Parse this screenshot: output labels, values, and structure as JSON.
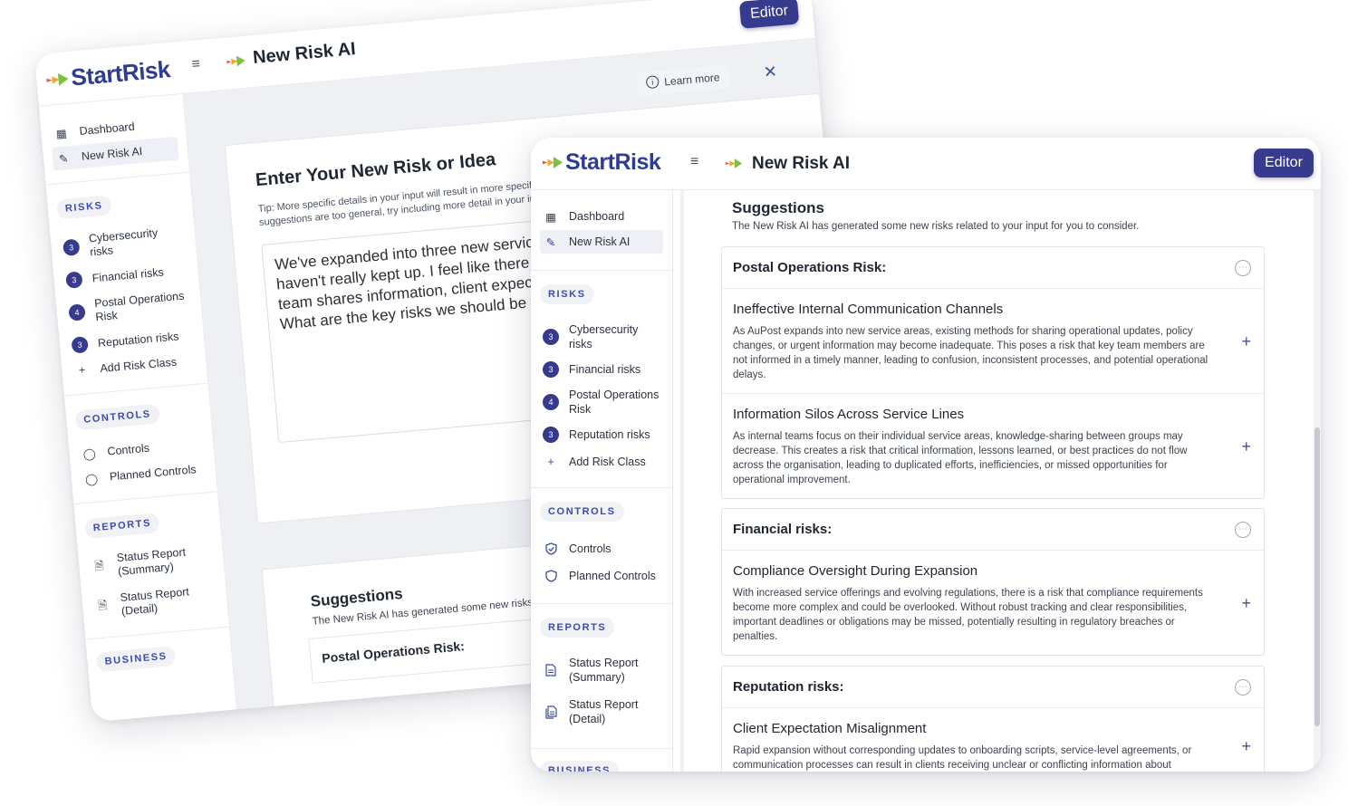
{
  "brand": {
    "logo_start": "Start",
    "logo_risk": "Risk"
  },
  "header": {
    "page_title": "New Risk AI",
    "editor_label": "Editor"
  },
  "sidebar": {
    "dashboard": "Dashboard",
    "new_risk_ai": "New Risk AI",
    "risks_label": "RISKS",
    "risk_classes": [
      {
        "count": "3",
        "line1": "Cybersecurity",
        "line2": "risks"
      },
      {
        "count": "3",
        "line1": "Financial risks",
        "line2": ""
      },
      {
        "count": "4",
        "line1": "Postal Operations",
        "line2": "Risk"
      },
      {
        "count": "3",
        "line1": "Reputation risks",
        "line2": ""
      }
    ],
    "add_risk_class": "Add Risk Class",
    "controls_label": "CONTROLS",
    "controls": "Controls",
    "planned_controls": "Planned Controls",
    "reports_label": "REPORTS",
    "status_summary_1": "Status Report",
    "status_summary_2": "(Summary)",
    "status_detail_1": "Status Report",
    "status_detail_2": "(Detail)",
    "business_label": "BUSINESS"
  },
  "back_window": {
    "learn_more": "Learn more",
    "card_title": "Enter Your New Risk or Idea",
    "tip_line1": "Tip: More specific details in your input will result in more specific",
    "tip_line2": "suggestions are too general, try including more detail in your input",
    "input_text": "We've expanded into three new service areas, but our internal processes haven't really kept up. I feel like there are gaps, especially around how our team shares information, client expectations, and keeps track of compliance. What are the key risks we should be thinking about?",
    "suggestions_title": "Suggestions",
    "suggestions_sub": "The New Risk AI has generated some new risks related to your input for you to consider.",
    "group_title": "Postal Operations Risk:"
  },
  "suggestions": {
    "title": "Suggestions",
    "subtitle": "The New Risk AI has generated some new risks related to your input for you to consider.",
    "groups": [
      {
        "title": "Postal Operations Risk:",
        "items": [
          {
            "title": "Ineffective Internal Communication Channels",
            "desc": "As AuPost expands into new service areas, existing methods for sharing operational updates, policy changes, or urgent information may become inadequate. This poses a risk that key team members are not informed in a timely manner, leading to confusion, inconsistent processes, and potential operational delays."
          },
          {
            "title": "Information Silos Across Service Lines",
            "desc": "As internal teams focus on their individual service areas, knowledge-sharing between groups may decrease. This creates a risk that critical information, lessons learned, or best practices do not flow across the organisation, leading to duplicated efforts, inefficiencies, or missed opportunities for operational improvement."
          }
        ]
      },
      {
        "title": "Financial risks:",
        "items": [
          {
            "title": "Compliance Oversight During Expansion",
            "desc": "With increased service offerings and evolving regulations, there is a risk that compliance requirements become more complex and could be overlooked. Without robust tracking and clear responsibilities, important deadlines or obligations may be missed, potentially resulting in regulatory breaches or penalties."
          }
        ]
      },
      {
        "title": "Reputation risks:",
        "items": [
          {
            "title": "Client Expectation Misalignment",
            "desc": "Rapid expansion without corresponding updates to onboarding scripts, service-level agreements, or communication processes can result in clients receiving unclear or conflicting information about"
          }
        ]
      }
    ]
  },
  "colors": {
    "brand_navy": "#363b8d",
    "accent_blue": "#3c4bb3",
    "arrow_green": "#7cc242",
    "arrow_orange": "#f5a623",
    "arrow_red": "#e94b3c"
  }
}
